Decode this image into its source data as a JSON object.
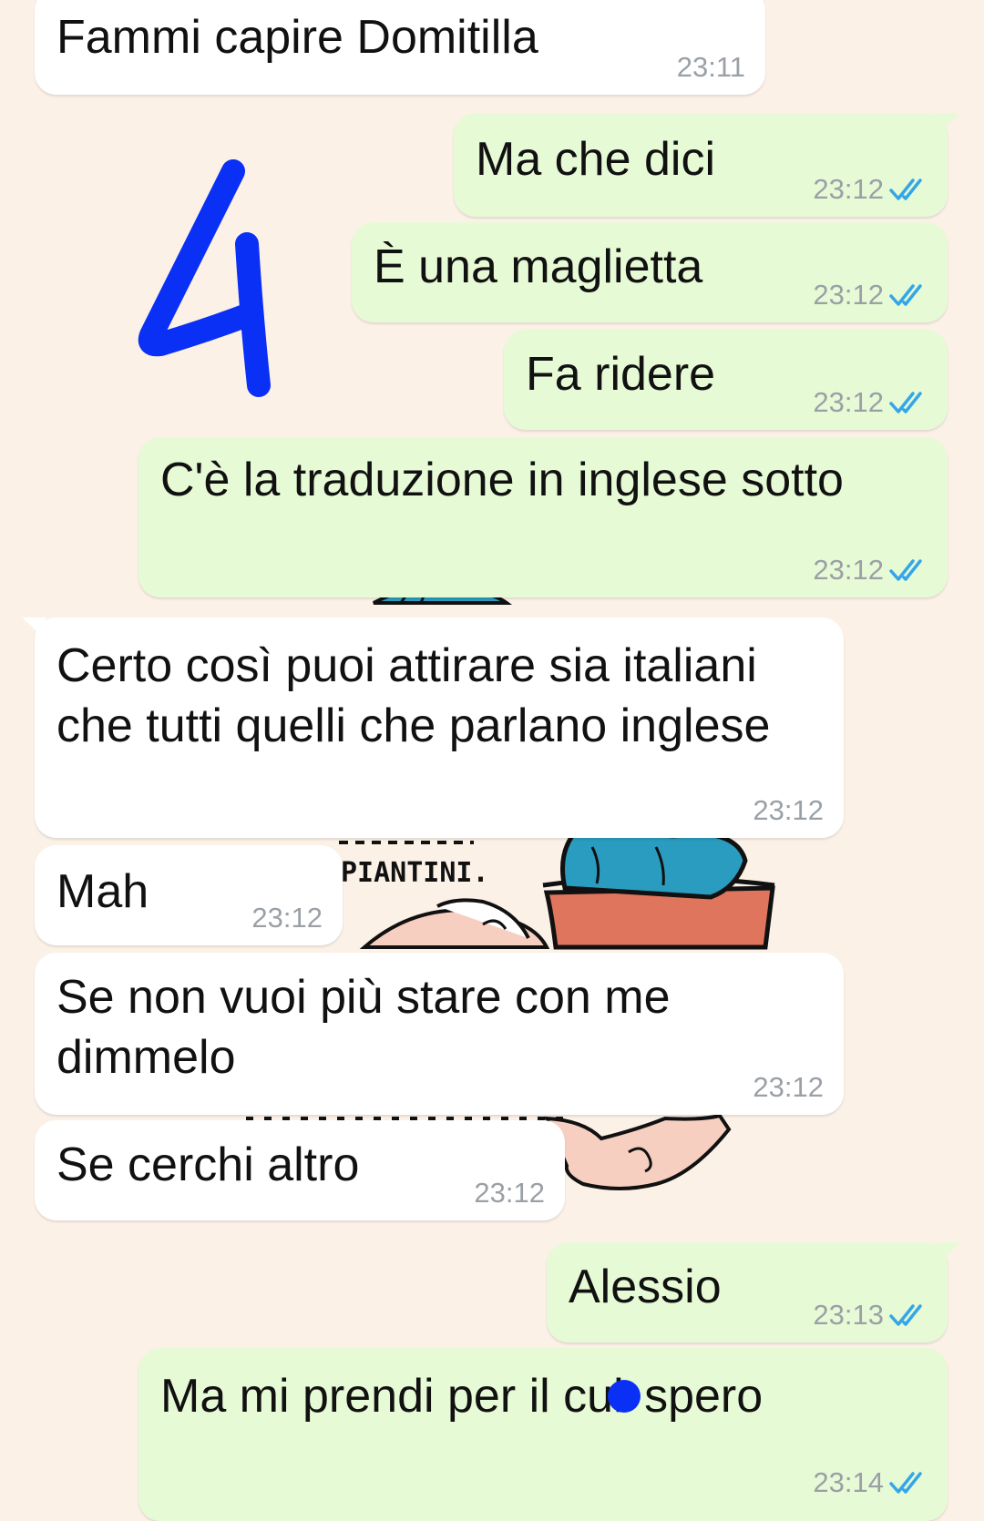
{
  "colors": {
    "background": "#fbf1e7",
    "incoming_bubble": "#ffffff",
    "outgoing_bubble": "#e7fad6",
    "read_ticks": "#34a6e8",
    "annotation_blue": "#0a2ff5"
  },
  "annotation": {
    "number": "4"
  },
  "wallpaper": {
    "sign_text": "PIANTINI."
  },
  "messages": [
    {
      "direction": "incoming",
      "text": "Fammi capire Domitilla",
      "time": "23:11"
    },
    {
      "direction": "outgoing",
      "text": "Ma che dici",
      "time": "23:12",
      "status": "read"
    },
    {
      "direction": "outgoing",
      "text": "È una maglietta",
      "time": "23:12",
      "status": "read"
    },
    {
      "direction": "outgoing",
      "text": "Fa ridere",
      "time": "23:12",
      "status": "read"
    },
    {
      "direction": "outgoing",
      "text": "C'è la traduzione in inglese sotto",
      "time": "23:12",
      "status": "read"
    },
    {
      "direction": "incoming",
      "text": "Certo così puoi attirare sia italiani che tutti quelli che parlano inglese",
      "time": "23:12"
    },
    {
      "direction": "incoming",
      "text": "Mah",
      "time": "23:12"
    },
    {
      "direction": "incoming",
      "text": "Se non vuoi più stare con me dimmelo",
      "time": "23:12"
    },
    {
      "direction": "incoming",
      "text": "Se cerchi altro",
      "time": "23:12"
    },
    {
      "direction": "outgoing",
      "text": "Alessio",
      "time": "23:13",
      "status": "read"
    },
    {
      "direction": "outgoing",
      "text_before": "Ma mi prendi per il cul",
      "text_after": " spero",
      "time": "23:14",
      "status": "read"
    }
  ]
}
